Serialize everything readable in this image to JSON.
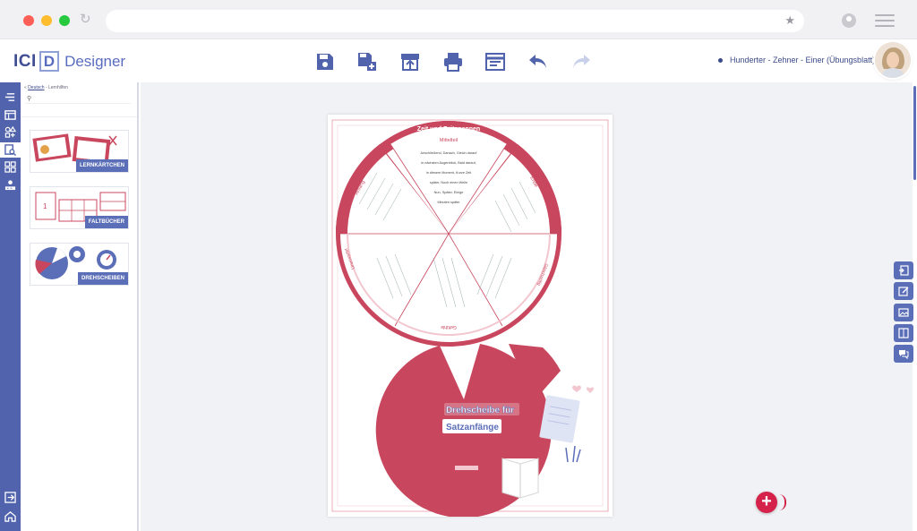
{
  "app": {
    "logo_main": "ICI",
    "logo_letter": "D",
    "logo_product": "Designer",
    "worksheet_title": "Hunderter - Zehner - Einer (Übungsblatt)"
  },
  "toolbar": [
    {
      "icon": "save-icon"
    },
    {
      "icon": "save-as-icon"
    },
    {
      "icon": "publish-icon"
    },
    {
      "icon": "print-icon"
    },
    {
      "icon": "page-settings-icon"
    },
    {
      "icon": "undo-icon"
    },
    {
      "icon": "redo-icon"
    }
  ],
  "panel": {
    "breadcrumb_back": "«",
    "breadcrumb_link": "Deutsch",
    "breadcrumb_rest": " - Lernhilfen",
    "search_placeholder": "",
    "cards": [
      {
        "label": "LERNKÄRTCHEN"
      },
      {
        "label": "FALTBÜCHER"
      },
      {
        "label": "DREHSCHEIBEN"
      }
    ]
  },
  "worksheet": {
    "wheel_title": "Zeit und Zeitspannen",
    "segment_top": "Mittelteil",
    "segment_left": "Anfang",
    "segment_right": "Ende",
    "segment_bottom": "Gefühle",
    "segment_lower_right": "Gleichzeitig",
    "segment_lower_left": "Unerwartet",
    "segment_lines_top": [
      "Anschließend, Danach, Gleich darauf",
      "in nächsten Augenblick, Bald darauf,",
      "In diesem Moment, Kurze Zeit",
      "später, Noch einen Weile",
      "Nun, Später, Einige",
      "Minuten später"
    ],
    "cover_title_line1": "Drehscheibe für",
    "cover_title_line2": "Satzanfänge"
  },
  "colors": {
    "brand": "#5163ad",
    "accent": "#c9475e",
    "fab": "#d4224a"
  },
  "right_tools": [
    {
      "icon": "insert-page-icon"
    },
    {
      "icon": "edit-icon"
    },
    {
      "icon": "image-icon"
    },
    {
      "icon": "book-icon"
    },
    {
      "icon": "chat-icon"
    }
  ],
  "fab": {
    "label": "+"
  }
}
